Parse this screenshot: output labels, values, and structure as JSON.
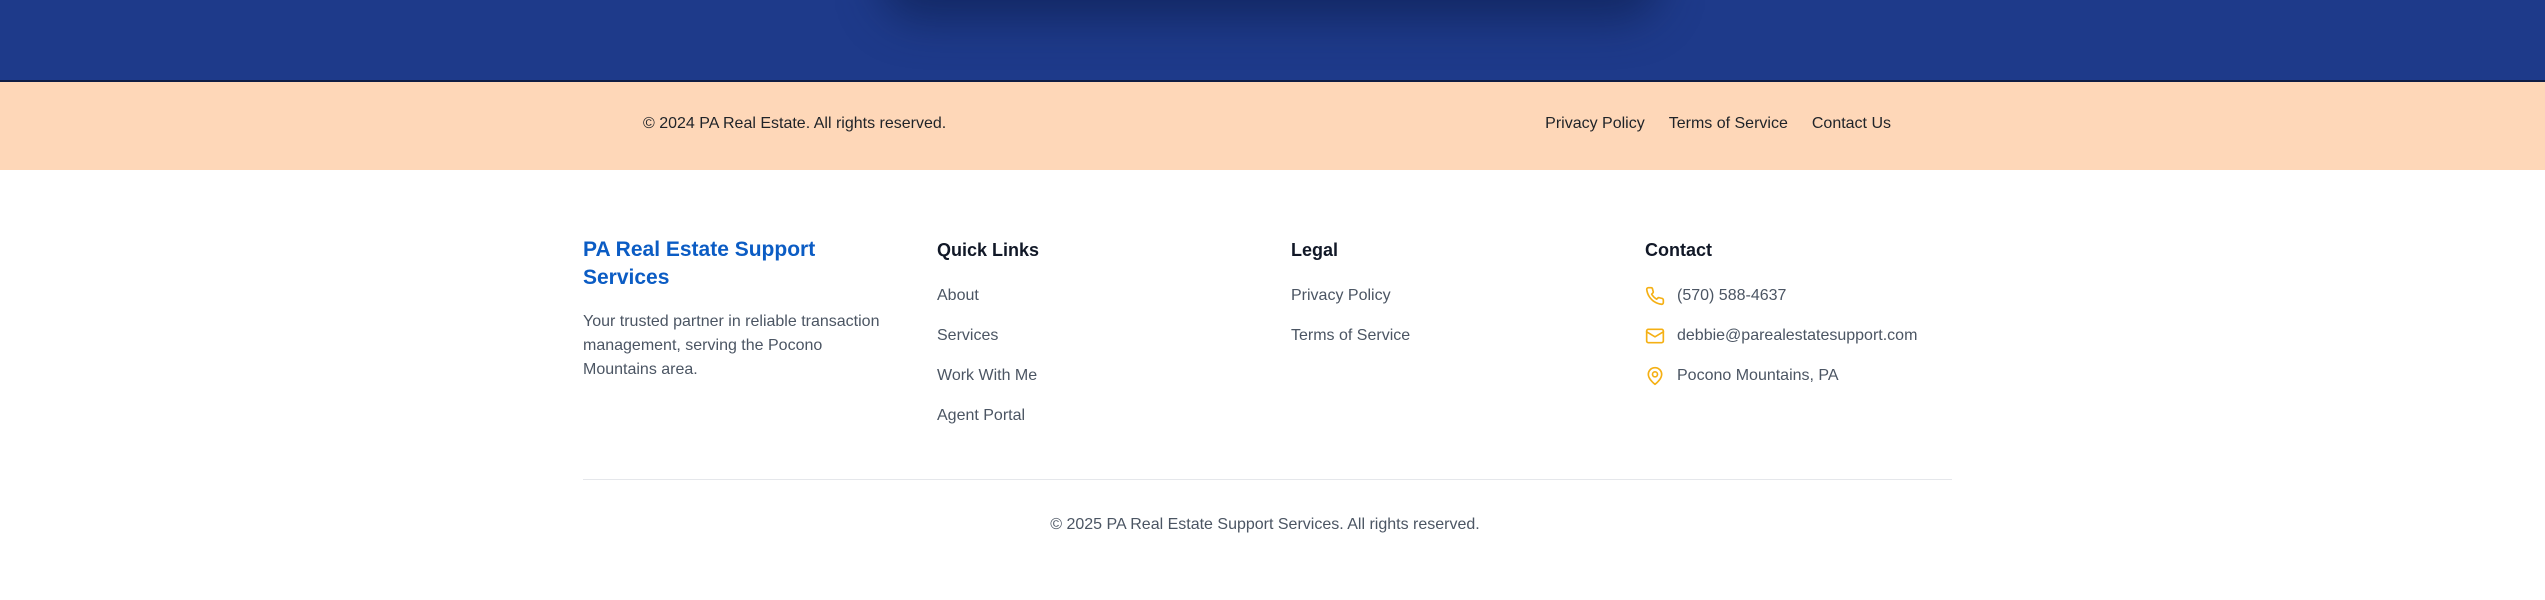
{
  "top_footer": {
    "copyright": "© 2024 PA Real Estate. All rights reserved.",
    "links": [
      "Privacy Policy",
      "Terms of Service",
      "Contact Us"
    ]
  },
  "brand": {
    "title": "PA Real Estate Support Services",
    "description": "Your trusted partner in reliable transaction management, serving the Pocono Mountains area."
  },
  "quick_links": {
    "heading": "Quick Links",
    "items": [
      "About",
      "Services",
      "Work With Me",
      "Agent Portal"
    ]
  },
  "legal": {
    "heading": "Legal",
    "items": [
      "Privacy Policy",
      "Terms of Service"
    ]
  },
  "contact": {
    "heading": "Contact",
    "phone": "(570) 588-4637",
    "email": "debbie@parealestatesupport.com",
    "location": "Pocono Mountains, PA",
    "icons": [
      "phone-icon",
      "mail-icon",
      "map-pin-icon"
    ]
  },
  "bottom_copyright": "© 2025 PA Real Estate Support Services. All rights reserved.",
  "colors": {
    "hero": "#1e3a8a",
    "top_footer_bg": "#fed7b8",
    "brand_accent": "#0b5cc4",
    "icon_accent": "#f5b014"
  }
}
